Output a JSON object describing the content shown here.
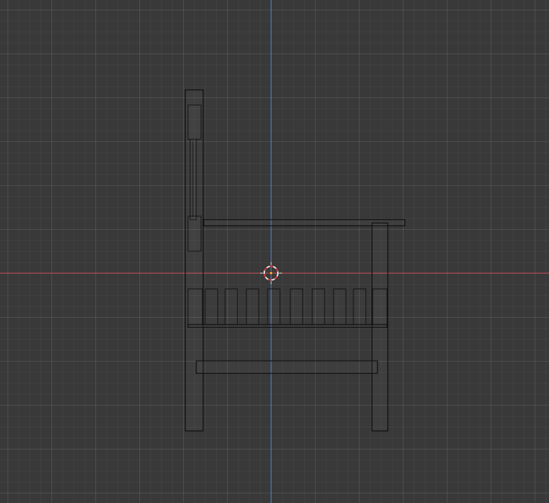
{
  "viewport": {
    "view": "side-orthographic",
    "background_color": "#393939",
    "grid": true,
    "colors": {
      "x_axis": "#c9484f",
      "z_axis": "#4f7ec2",
      "wireframe": "#0d0d0d",
      "origin_fill": "#e8a03a",
      "cursor_ring": "#e8e8e8",
      "cursor_ring_alt": "#d33b3b"
    }
  },
  "objects": [
    {
      "name": "chair",
      "type": "mesh",
      "display": "wireframe"
    }
  ],
  "cursor": {
    "icon": "3d-cursor-icon"
  },
  "origin": {
    "icon": "object-origin-icon"
  }
}
